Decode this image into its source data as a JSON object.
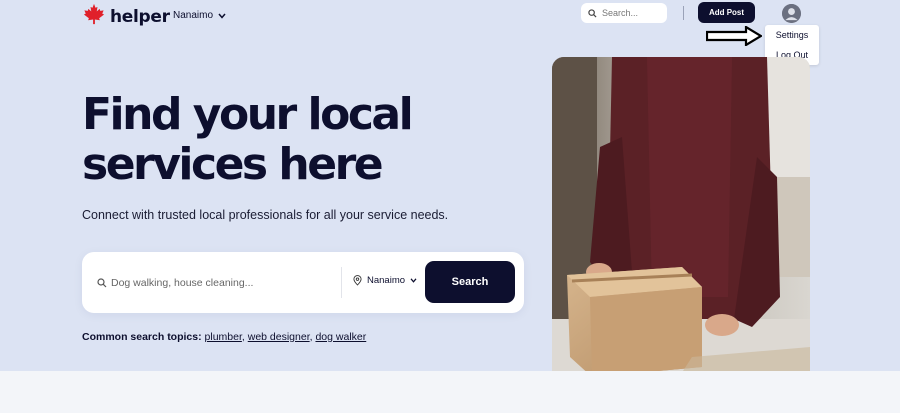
{
  "brand": {
    "name": "helper",
    "logo_icon": "maple-leaf-icon",
    "logo_color": "#e0202a"
  },
  "header": {
    "city": "Nanaimo",
    "search_placeholder": "Search...",
    "add_post_label": "Add Post",
    "avatar_icon": "user-avatar-icon"
  },
  "user_menu": {
    "items": [
      "Settings",
      "Log Out"
    ]
  },
  "hero": {
    "title_line1": "Find your local",
    "title_line2": "services here",
    "subtitle": "Connect with trusted local professionals for all your service needs."
  },
  "search": {
    "placeholder": "Dog walking, house cleaning...",
    "location": "Nanaimo",
    "button_label": "Search"
  },
  "topics": {
    "label": "Common search topics:",
    "links": [
      "plumber",
      "web designer",
      "dog walker"
    ]
  },
  "colors": {
    "background": "#dce3f3",
    "primary": "#0d0f2e",
    "footer": "#f3f5f9"
  }
}
